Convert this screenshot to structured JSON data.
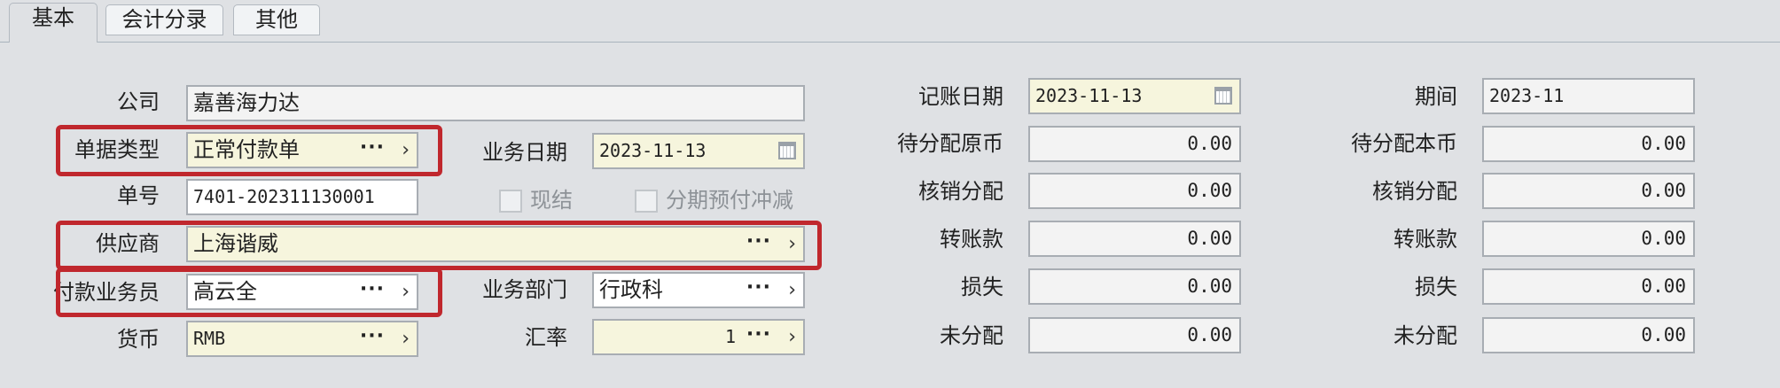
{
  "tabs": [
    "基本",
    "会计分录",
    "其他"
  ],
  "left": {
    "company": {
      "label": "公司",
      "value": "嘉善海力达"
    },
    "doc_type": {
      "label": "单据类型",
      "value": "正常付款单"
    },
    "doc_no": {
      "label": "单号",
      "value": "7401-202311130001"
    },
    "supplier": {
      "label": "供应商",
      "value": "上海谐威"
    },
    "payer": {
      "label": "付款业务员",
      "value": "高云全"
    },
    "currency": {
      "label": "货币",
      "value": "RMB"
    }
  },
  "middle": {
    "biz_date": {
      "label": "业务日期",
      "value": "2023-11-13"
    },
    "settled": {
      "label": "现结",
      "checked": false
    },
    "installment": {
      "label": "分期预付冲减",
      "checked": false
    },
    "dept": {
      "label": "业务部门",
      "value": "行政科"
    },
    "rate": {
      "label": "汇率",
      "value": "1"
    }
  },
  "right1": {
    "post_date": {
      "label": "记账日期",
      "value": "2023-11-13"
    },
    "unalloc_orig": {
      "label": "待分配原币",
      "value": "0.00"
    },
    "writeoff": {
      "label": "核销分配",
      "value": "0.00"
    },
    "transfer": {
      "label": "转账款",
      "value": "0.00"
    },
    "loss": {
      "label": "损失",
      "value": "0.00"
    },
    "unalloc": {
      "label": "未分配",
      "value": "0.00"
    }
  },
  "right2": {
    "period": {
      "label": "期间",
      "value": "2023-11"
    },
    "unalloc_local": {
      "label": "待分配本币",
      "value": "0.00"
    },
    "writeoff": {
      "label": "核销分配",
      "value": "0.00"
    },
    "transfer": {
      "label": "转账款",
      "value": "0.00"
    },
    "loss": {
      "label": "损失",
      "value": "0.00"
    },
    "unalloc": {
      "label": "未分配",
      "value": "0.00"
    }
  },
  "colors": {
    "highlight": "#c0272d",
    "required_bg": "#f6f5dd",
    "readonly_bg": "#f3f3f3"
  }
}
